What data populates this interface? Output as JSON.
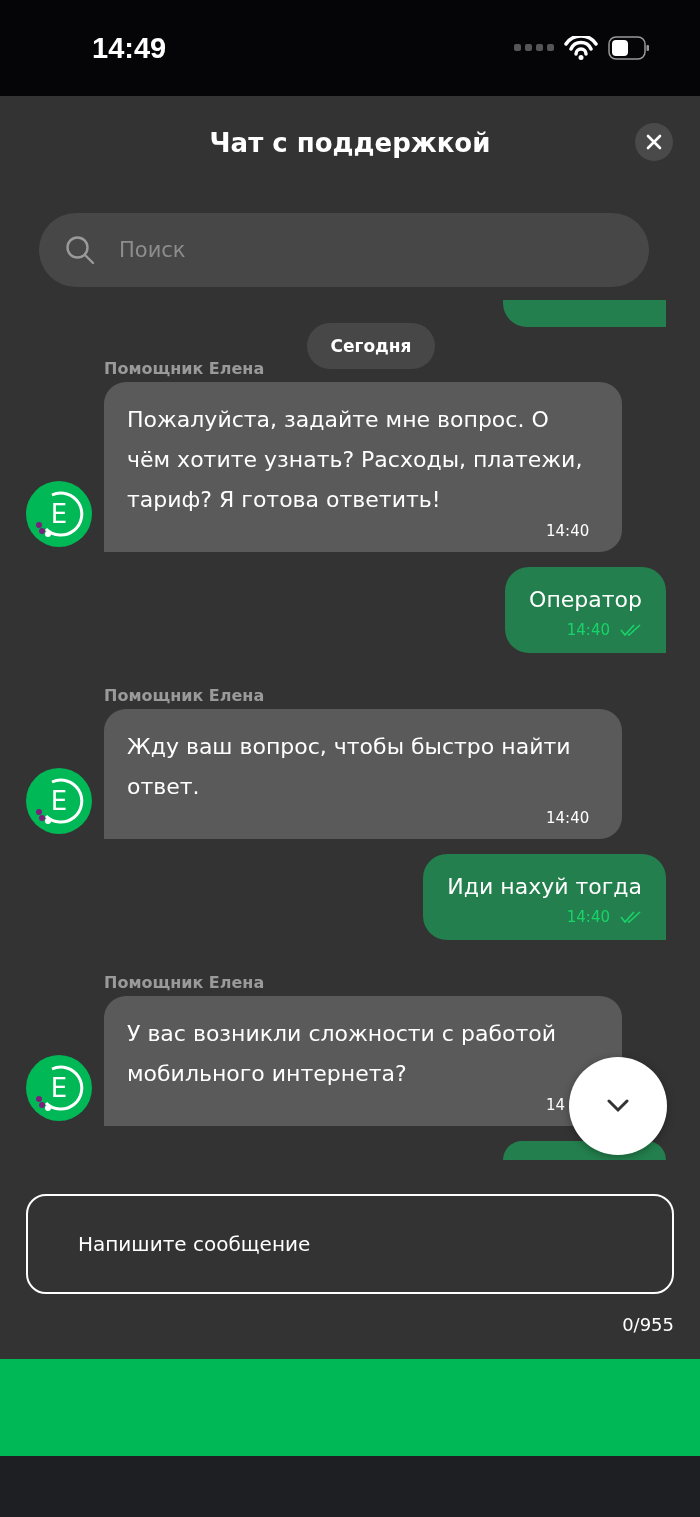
{
  "status_bar": {
    "time": "14:49"
  },
  "header": {
    "title": "Чат с поддержкой"
  },
  "search": {
    "placeholder": "Поиск"
  },
  "messages": [
    {
      "kind": "user_clipped_top"
    },
    {
      "kind": "date",
      "text": "Сегодня"
    },
    {
      "kind": "bot",
      "sender": "Помощник Елена",
      "avatar_letter": "E",
      "text": "Пожалуйста, задайте мне вопрос. О чём хотите узнать? Расходы, платежи, тариф? Я готова ответить!",
      "time": "14:40"
    },
    {
      "kind": "user",
      "text": "Оператор",
      "time": "14:40",
      "read": true
    },
    {
      "kind": "bot",
      "sender": "Помощник Елена",
      "avatar_letter": "E",
      "text": "Жду ваш вопрос, чтобы быстро найти ответ.",
      "time": "14:40"
    },
    {
      "kind": "user",
      "text": "Иди нахуй тогда",
      "time": "14:40",
      "read": true
    },
    {
      "kind": "bot",
      "sender": "Помощник Елена",
      "avatar_letter": "E",
      "text": "У вас возникли сложности с работой мобильного интернета?",
      "time": "14"
    },
    {
      "kind": "user_clipped_bottom"
    }
  ],
  "composer": {
    "placeholder": "Напишите сообщение",
    "counter": "0/955"
  }
}
